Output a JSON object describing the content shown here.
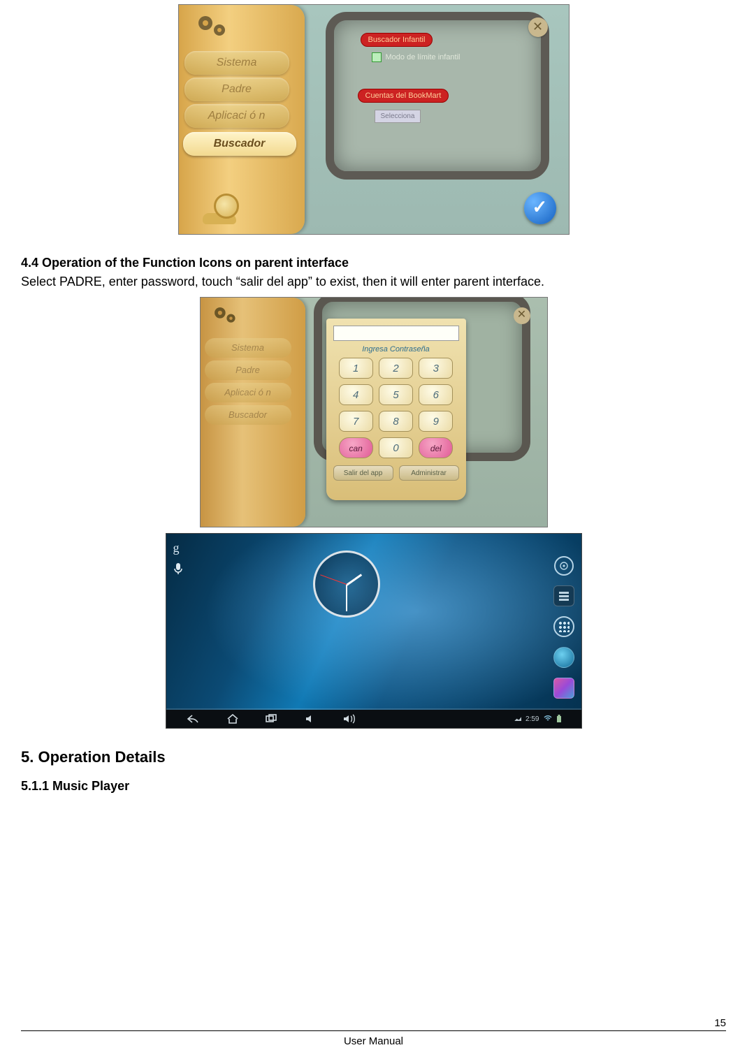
{
  "screenshot1": {
    "tabs": {
      "sistema": "Sistema",
      "padre": "Padre",
      "aplicacion": "Aplicaci ó n",
      "buscador": "Buscador"
    },
    "redtag1": "Buscador Infantil",
    "limit_label": "Modo de límite infantil",
    "redtag2": "Cuentas del BookMart",
    "select_btn": "Selecciona",
    "close": "✕"
  },
  "section44": {
    "heading": "4.4 Operation of the Function Icons on parent interface",
    "body": "Select PADRE, enter password, touch “salir del app” to exist, then it will enter parent interface."
  },
  "screenshot2": {
    "tabs": {
      "sistema": "Sistema",
      "padre": "Padre",
      "aplicacion": "Aplicaci ó n",
      "buscador": "Buscador"
    },
    "kp_label": "Ingresa Contraseña",
    "keys": [
      "1",
      "2",
      "3",
      "4",
      "5",
      "6",
      "7",
      "8",
      "9"
    ],
    "key_can": "can",
    "key_0": "0",
    "key_del": "del",
    "foot_left": "Salir del app",
    "foot_right": "Administrar",
    "close": "✕"
  },
  "screenshot3": {
    "g": "g",
    "time": "2:59"
  },
  "section5": {
    "heading": "5. Operation Details"
  },
  "section511": {
    "heading": "5.1.1 Music Player"
  },
  "footer": {
    "label": "User Manual",
    "page": "15"
  }
}
